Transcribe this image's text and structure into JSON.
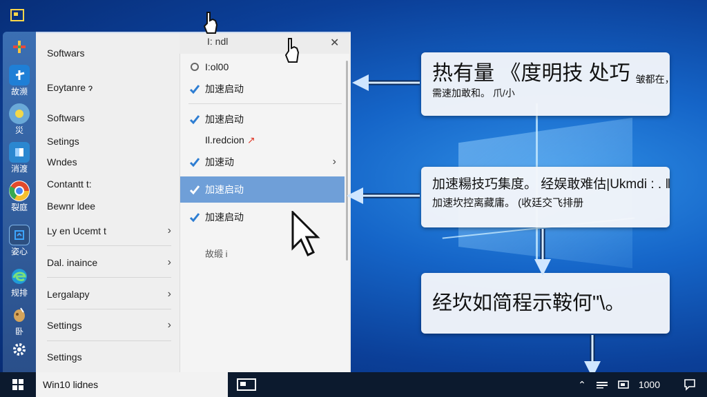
{
  "menu": {
    "title": "I: ndl",
    "left_items": [
      {
        "label": "Softwars",
        "chevron": false
      },
      {
        "label": "Eoytanre ɂ",
        "chevron": false
      },
      {
        "label": "Softwars",
        "chevron": false
      },
      {
        "label": "Setings",
        "chevron": false
      },
      {
        "label": "Wndes",
        "chevron": false
      },
      {
        "label": "Contantt t:",
        "chevron": false
      },
      {
        "label": "Bewnr ldee",
        "chevron": false
      },
      {
        "label": "Ly en Ucemt t",
        "chevron": true
      },
      {
        "label": "Dal. inaince",
        "chevron": true
      },
      {
        "label": "Lergalapy",
        "chevron": true
      },
      {
        "label": "Settings",
        "chevron": true
      },
      {
        "label": "Settings",
        "chevron": false
      }
    ],
    "flyout_items": [
      {
        "label": "I:ol00",
        "icon": "disk-icon"
      },
      {
        "label": "加速启动",
        "icon": "check-icon"
      },
      {
        "label": "加速启动",
        "icon": "check-icon"
      },
      {
        "label": "Il.redcion",
        "icon": ""
      },
      {
        "label": "加速动",
        "icon": "check-icon",
        "chevron": true
      },
      {
        "label": "加速启动",
        "icon": "check-icon",
        "selected": true
      },
      {
        "label": "加速启动",
        "icon": "check-icon"
      },
      {
        "label": "故缎 i",
        "icon": ""
      }
    ]
  },
  "rail": [
    {
      "label": "",
      "icon": "plus-colorful-icon",
      "color": "#3b6fb3"
    },
    {
      "label": "故濒",
      "icon": "blue-tile-icon",
      "color": "#1f7fd6"
    },
    {
      "label": "災",
      "icon": "chat-icon",
      "color": "#6aa9d8"
    },
    {
      "label": "消渡",
      "icon": "window-tile-icon",
      "color": "#2b87d0"
    },
    {
      "label": "裂庭",
      "icon": "chrome-icon",
      "color": "#e24a2b"
    },
    {
      "label": "姿心",
      "icon": "network-icon",
      "color": "#3ea6ff"
    },
    {
      "label": "规排",
      "icon": "edge-icon",
      "color": "#1f9bd9"
    },
    {
      "label": "卧",
      "icon": "brush-icon",
      "color": "#d5a45b"
    },
    {
      "label": "",
      "icon": "gear-icon",
      "color": "#ffffff"
    }
  ],
  "callouts": [
    {
      "line1": "热有量 《度明技 处巧",
      "line1b": "皱都在，",
      "line2": "需速加敢和。 爪/小"
    },
    {
      "line1": "加速糃技巧集度。 经娱敢难估|Ukmdi : . ‖",
      "line2": "加速坎控离藏庸。 (收廷交飞排册"
    },
    {
      "line1": "经坎如简程示鞍何\"\\。"
    }
  ],
  "taskbar": {
    "search_text": "Win10 lidnes",
    "clock": "1000"
  }
}
